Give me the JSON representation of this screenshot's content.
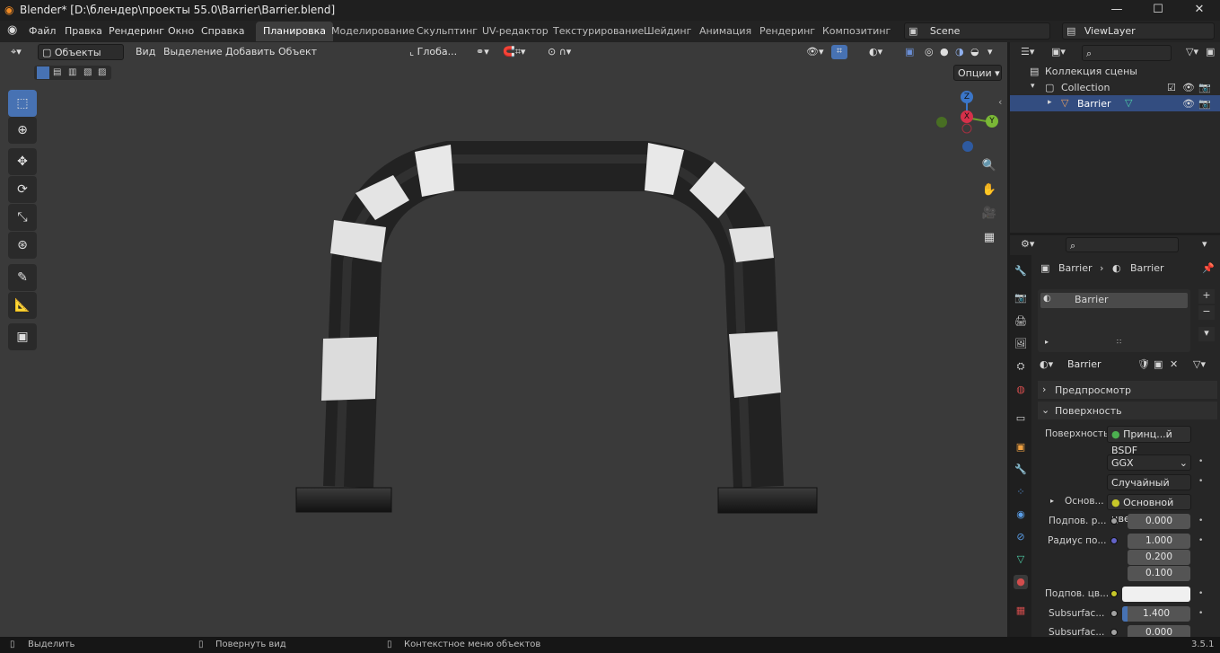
{
  "window": {
    "title": "Blender* [D:\\блендер\\проекты 55.0\\Barrier\\Barrier.blend]",
    "min": "—",
    "max": "☐",
    "close": "✕"
  },
  "menu": [
    "Файл",
    "Правка",
    "Рендеринг",
    "Окно",
    "Справка"
  ],
  "workspaces": [
    "Планировка",
    "Моделирование",
    "Скульптинг",
    "UV-редактор",
    "Текстурирование",
    "Шейдинг",
    "Анимация",
    "Рендеринг",
    "Композитинг"
  ],
  "scene": {
    "label": "Scene",
    "viewlayer": "ViewLayer"
  },
  "viewport": {
    "mode": "Объекты",
    "menu": [
      "Вид",
      "Выделение",
      "Добавить",
      "Объект"
    ],
    "orientation": "Глоба...",
    "options": "Опции",
    "axes": {
      "x": "X",
      "y": "Y",
      "z": "Z"
    }
  },
  "outliner": {
    "scene_collection": "Коллекция сцены",
    "collection": "Collection",
    "object": "Barrier"
  },
  "properties": {
    "breadcrumb_object": "Barrier",
    "breadcrumb_material": "Barrier",
    "slot": "Barrier",
    "material_name": "Barrier",
    "preview_panel": "Предпросмотр",
    "surface_panel": "Поверхность",
    "surface_label": "Поверхность",
    "surface_value": "Принц...й BSDF",
    "distribution": "GGX",
    "subsurface_method": "Случайный об...",
    "base_label": "Основ...",
    "base_value": "Основной цвет",
    "subsurface_label": "Подпов. р...",
    "subsurface_value": "0.000",
    "radius_label": "Радиус по...",
    "radius_values": [
      "1.000",
      "0.200",
      "0.100"
    ],
    "subcolor_label": "Подпов. цв...",
    "ior_label": "Subsurfac...",
    "ior_value": "1.400",
    "aniso_label": "Subsurfac...",
    "aniso_value": "0.000"
  },
  "status": {
    "select": "Выделить",
    "rotate": "Повернуть вид",
    "context": "Контекстное меню объектов",
    "version": "3.5.1"
  }
}
